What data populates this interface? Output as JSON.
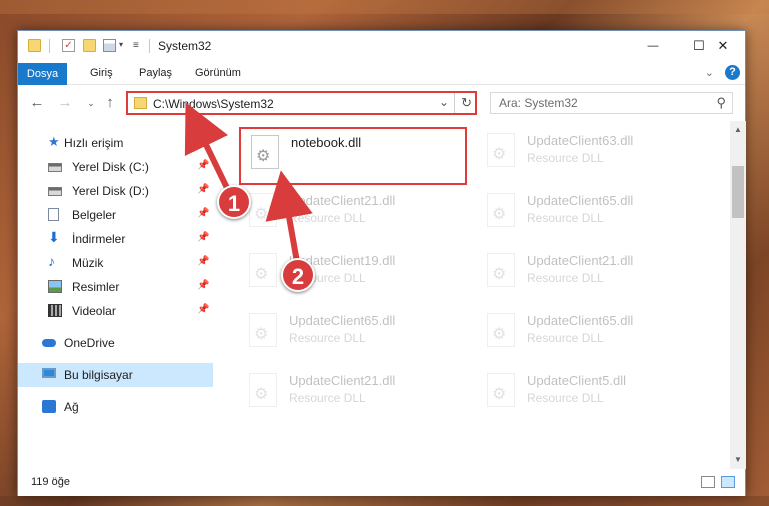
{
  "window": {
    "title": "System32",
    "minimize": "—",
    "maximize": "☐",
    "close": "✕"
  },
  "ribbon": {
    "file_tab": "Dosya",
    "tabs": [
      "Giriş",
      "Paylaş",
      "Görünüm"
    ]
  },
  "address": {
    "path": "C:\\Windows\\System32",
    "search_placeholder": "Ara: System32"
  },
  "nav_pane": {
    "items": [
      {
        "label": "Hızlı erişim",
        "icon": "star-icon"
      },
      {
        "label": "Yerel Disk (C:)",
        "icon": "drive-icon",
        "pinned": true
      },
      {
        "label": "Yerel Disk (D:)",
        "icon": "drive-icon",
        "pinned": true
      },
      {
        "label": "Belgeler",
        "icon": "documents-icon",
        "pinned": true
      },
      {
        "label": "İndirmeler",
        "icon": "downloads-icon",
        "pinned": true
      },
      {
        "label": "Müzik",
        "icon": "music-icon",
        "pinned": true
      },
      {
        "label": "Resimler",
        "icon": "pictures-icon",
        "pinned": true
      },
      {
        "label": "Videolar",
        "icon": "videos-icon",
        "pinned": true
      },
      {
        "label": "OneDrive",
        "icon": "onedrive-icon"
      },
      {
        "label": "Bu bilgisayar",
        "icon": "computer-icon",
        "selected": true
      },
      {
        "label": "Ağ",
        "icon": "network-icon"
      }
    ]
  },
  "files": [
    {
      "name": "notebook.dll",
      "type": ""
    },
    {
      "name": "UpdateClient63.dll",
      "type": "Resource DLL"
    },
    {
      "name": "UpdateClient21.dll",
      "type": "Resource DLL"
    },
    {
      "name": "UpdateClient65.dll",
      "type": "Resource DLL"
    },
    {
      "name": "UpdateClient19.dll",
      "type": "Resource DLL"
    },
    {
      "name": "UpdateClient21.dll",
      "type": "Resource DLL"
    },
    {
      "name": "UpdateClient65.dll",
      "type": "Resource DLL"
    },
    {
      "name": "UpdateClient65.dll",
      "type": "Resource DLL"
    },
    {
      "name": "UpdateClient21.dll",
      "type": "Resource DLL"
    },
    {
      "name": "UpdateClient5.dll",
      "type": "Resource DLL"
    }
  ],
  "status": {
    "item_count": "119 öğe"
  },
  "callouts": [
    "1",
    "2"
  ],
  "colors": {
    "accent": "#1979ca",
    "highlight": "#e03a3a",
    "selected": "#cce8ff"
  }
}
